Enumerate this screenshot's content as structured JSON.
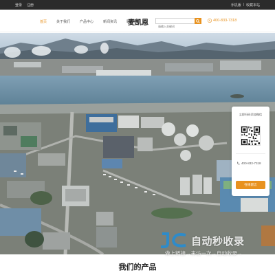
{
  "topbar": {
    "login": "登录",
    "register": "注册",
    "mobile": "手机版",
    "separator": "|",
    "favorite": "收藏本站"
  },
  "nav": {
    "items": [
      {
        "label": "首页",
        "active": true
      },
      {
        "label": "关于我们",
        "active": false
      },
      {
        "label": "产品中心",
        "active": false
      },
      {
        "label": "新闻资讯",
        "active": false
      },
      {
        "label": "联系我们",
        "active": false
      }
    ]
  },
  "logo": {
    "text": "麦凯恩"
  },
  "search": {
    "placeholder": "请输入关键词"
  },
  "phone": {
    "number": "400-833-7318"
  },
  "side_widget": {
    "title": "立即扫码添加微信",
    "phone": "400-833-7318",
    "cta": "在线留言"
  },
  "watermark": {
    "title": "自动秒收录",
    "subtitle": "做上链接→来访一次→自动收录→"
  },
  "products": {
    "title": "我们的产品"
  },
  "colors": {
    "accent": "#e8921f",
    "topbar": "#2b2b2b"
  }
}
